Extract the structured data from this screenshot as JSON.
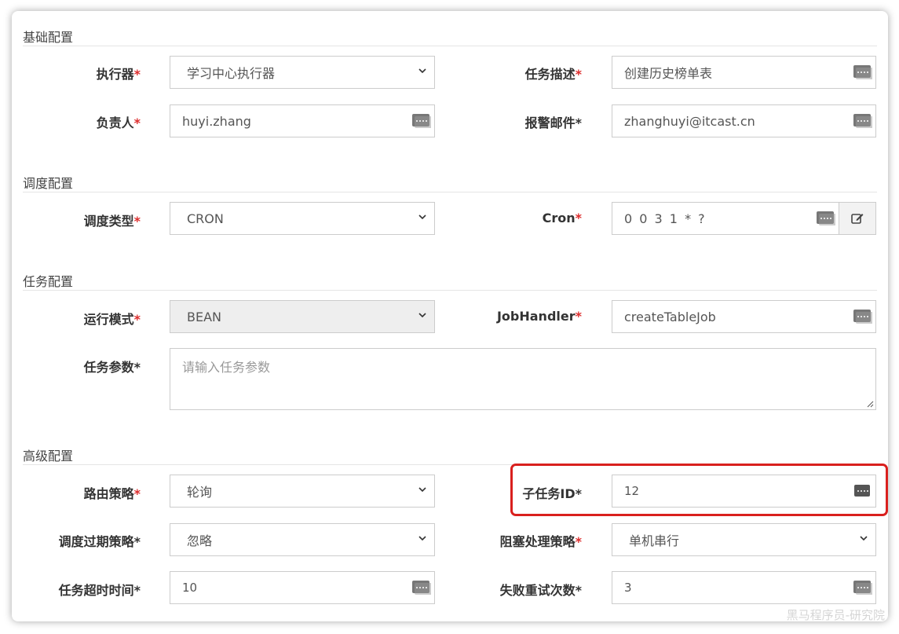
{
  "sections": {
    "basic": "基础配置",
    "schedule": "调度配置",
    "task": "任务配置",
    "advanced": "高级配置"
  },
  "fields": {
    "executor": {
      "label": "执行器",
      "value": "学习中心执行器"
    },
    "job_desc": {
      "label": "任务描述",
      "value": "创建历史榜单表"
    },
    "author": {
      "label": "负责人",
      "value": "huyi.zhang"
    },
    "alarm_email": {
      "label": "报警邮件",
      "value": "zhanghuyi@itcast.cn"
    },
    "schedule_type": {
      "label": "调度类型",
      "value": "CRON"
    },
    "cron": {
      "label": "Cron",
      "value": "0 0 3 1 * ?"
    },
    "glue_type": {
      "label": "运行模式",
      "value": "BEAN"
    },
    "job_handler": {
      "label": "JobHandler",
      "value": "createTableJob"
    },
    "job_param": {
      "label": "任务参数",
      "placeholder": "请输入任务参数"
    },
    "route_strategy": {
      "label": "路由策略",
      "value": "轮询"
    },
    "child_job_id": {
      "label": "子任务ID",
      "value": "12"
    },
    "misfire_strategy": {
      "label": "调度过期策略",
      "value": "忽略"
    },
    "block_strategy": {
      "label": "阻塞处理策略",
      "value": "单机串行"
    },
    "timeout": {
      "label": "任务超时时间",
      "value": "10"
    },
    "fail_retry": {
      "label": "失败重试次数",
      "value": "3"
    }
  },
  "required_mark": "*",
  "watermark": "黑马程序员-研究院",
  "colors": {
    "required": "#dd2c2c",
    "highlight": "#d9201e"
  }
}
